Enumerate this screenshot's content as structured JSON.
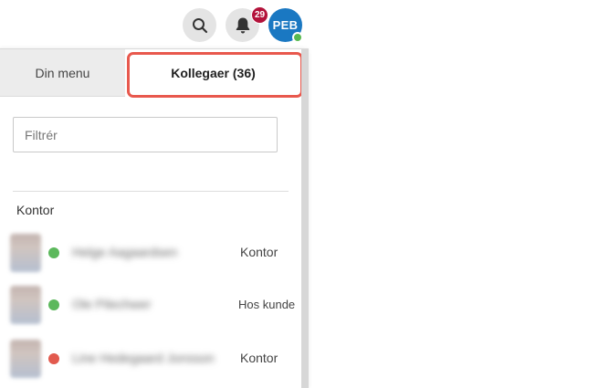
{
  "topbar": {
    "search_icon": "search-icon",
    "bell_icon": "bell-icon",
    "notification_count": "29",
    "user_initials": "PEB",
    "colors": {
      "icon_bg": "#e4e4e4",
      "badge": "#b3123a",
      "avatar": "#1a78c2",
      "online": "#58b950"
    }
  },
  "tabs": [
    {
      "label": "Din menu"
    },
    {
      "label": "Kollegaer (36)"
    }
  ],
  "filter": {
    "placeholder": "Filtrér",
    "value": ""
  },
  "group": {
    "title": "Kontor",
    "people": [
      {
        "name": "Helge Aagaardsen",
        "status": "online",
        "status_color": "#5cb85c",
        "location": "Kontor"
      },
      {
        "name": "Ole Pilechwer",
        "status": "online",
        "status_color": "#5cb85c",
        "location": "Hos kunde"
      },
      {
        "name": "Line Hedegaard Jonsson",
        "status": "busy",
        "status_color": "#e25a4e",
        "location": "Kontor"
      }
    ]
  },
  "highlight_color": "#e8584d"
}
